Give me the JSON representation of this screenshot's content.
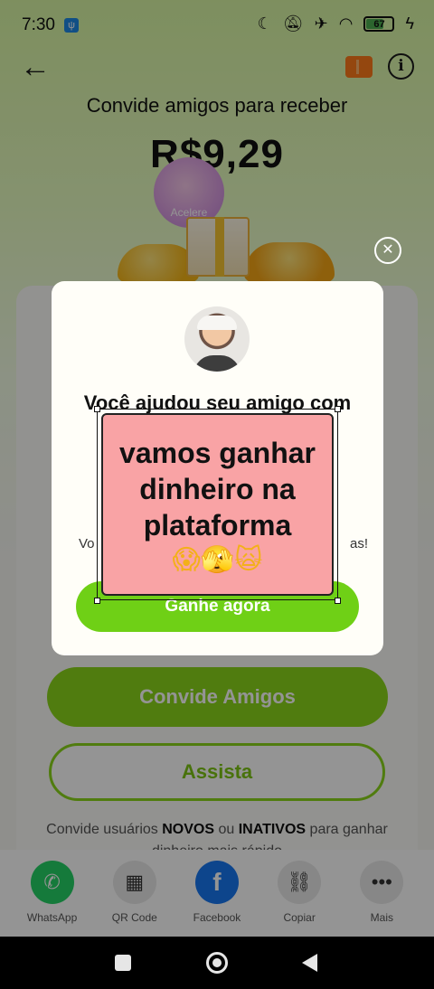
{
  "status_bar": {
    "time": "7:30",
    "battery": "67"
  },
  "header": {
    "back_icon": "arrow-left-icon",
    "ticket_icon": "ticket-icon",
    "info_icon": "info-icon"
  },
  "page": {
    "title": "Convide amigos para receber",
    "amount": "R$9,29",
    "accelerate_label": "Acelere"
  },
  "buttons": {
    "invite_friends": "Convide Amigos",
    "watch": "Assista"
  },
  "hint": {
    "part1": "Convide usuários ",
    "bold1": "NOVOS",
    "part2": " ou ",
    "bold2": "INATIVOS",
    "part3": " para ganhar dinheiro mais rápido"
  },
  "share": [
    {
      "label": "WhatsApp",
      "icon": "whatsapp-icon",
      "color": "#25d366"
    },
    {
      "label": "QR Code",
      "icon": "qr-code-icon",
      "color": "#e9e9e9"
    },
    {
      "label": "Facebook",
      "icon": "facebook-icon",
      "color": "#1877f2"
    },
    {
      "label": "Copiar",
      "icon": "link-icon",
      "color": "#e9e9e9"
    },
    {
      "label": "Mais",
      "icon": "more-icon",
      "color": "#e9e9e9"
    }
  ],
  "modal": {
    "title": "Você ajudou seu amigo com",
    "body_start": "Vo",
    "body_end": "as!",
    "button": "Ganhe agora",
    "close_icon": "close-icon"
  },
  "sticker": {
    "line1": "vamos ganhar",
    "line2": "dinheiro na",
    "line3": "plataforma",
    "emoji": "😱🫣🙀"
  },
  "nav": {
    "recents_icon": "square-icon",
    "home_icon": "circle-icon",
    "back_icon": "triangle-back-icon"
  }
}
